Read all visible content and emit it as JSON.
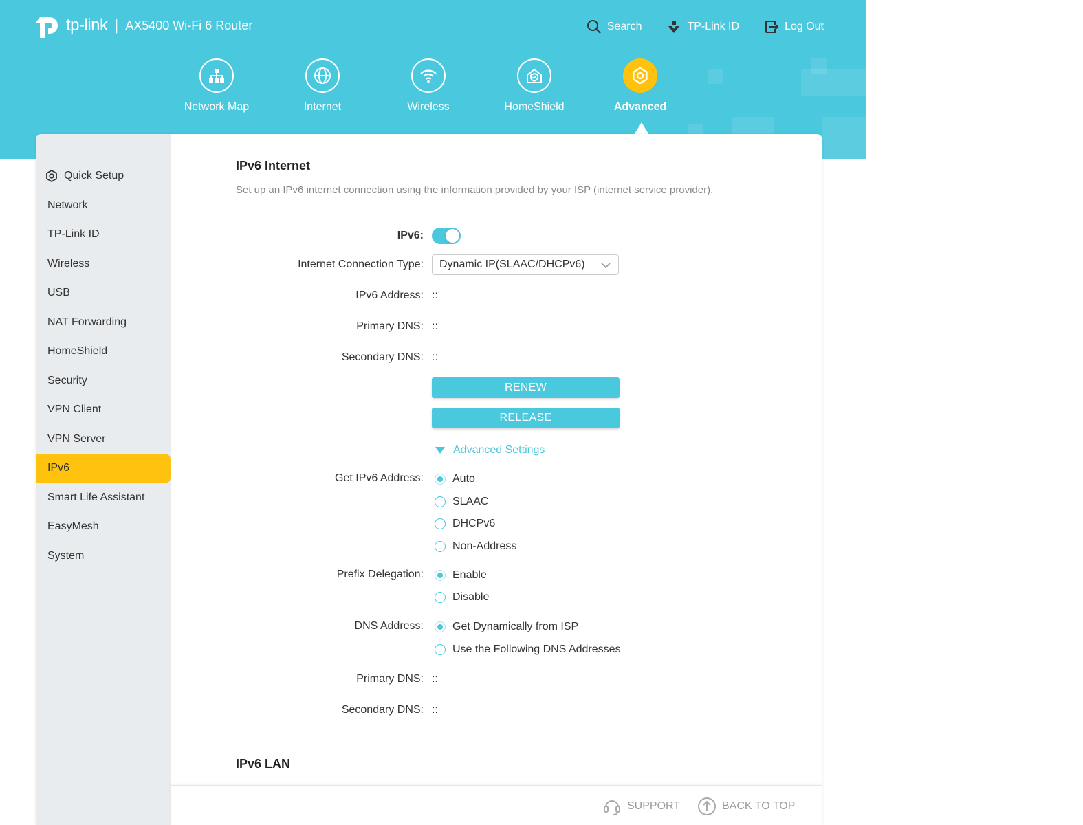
{
  "header": {
    "brand": "tp-link",
    "separator": "|",
    "model": "AX5400 Wi-Fi 6 Router",
    "links": {
      "search": "Search",
      "tplink_id": "TP-Link ID",
      "logout": "Log Out"
    }
  },
  "nav": {
    "network_map": "Network Map",
    "internet": "Internet",
    "wireless": "Wireless",
    "homeshield": "HomeShield",
    "advanced": "Advanced"
  },
  "sidebar": {
    "items": [
      "Quick Setup",
      "Network",
      "TP-Link ID",
      "Wireless",
      "USB",
      "NAT Forwarding",
      "HomeShield",
      "Security",
      "VPN Client",
      "VPN Server",
      "IPv6",
      "Smart Life Assistant",
      "EasyMesh",
      "System"
    ],
    "active": "IPv6"
  },
  "ipv6_internet": {
    "title": "IPv6 Internet",
    "description": "Set up an IPv6 internet connection using the information provided by your ISP (internet service provider).",
    "ipv6_label": "IPv6:",
    "ipv6_enabled": true,
    "connection_type_label": "Internet Connection Type:",
    "connection_type_value": "Dynamic IP(SLAAC/DHCPv6)",
    "ipv6_address_label": "IPv6 Address:",
    "ipv6_address_value": "::",
    "primary_dns_label": "Primary DNS:",
    "primary_dns_value": "::",
    "secondary_dns_label": "Secondary DNS:",
    "secondary_dns_value": "::",
    "renew_button": "RENEW",
    "release_button": "RELEASE",
    "advanced_settings": "Advanced Settings",
    "get_address_label": "Get IPv6 Address:",
    "get_address_options": [
      "Auto",
      "SLAAC",
      "DHCPv6",
      "Non-Address"
    ],
    "get_address_selected": "Auto",
    "prefix_delegation_label": "Prefix Delegation:",
    "prefix_delegation_options": [
      "Enable",
      "Disable"
    ],
    "prefix_delegation_selected": "Enable",
    "dns_address_label": "DNS Address:",
    "dns_address_options": [
      "Get Dynamically from ISP",
      "Use the Following DNS Addresses"
    ],
    "dns_address_selected": "Get Dynamically from ISP",
    "adv_primary_dns_label": "Primary DNS:",
    "adv_primary_dns_value": "::",
    "adv_secondary_dns_label": "Secondary DNS:",
    "adv_secondary_dns_value": "::"
  },
  "ipv6_lan": {
    "title": "IPv6 LAN"
  },
  "footer": {
    "support": "SUPPORT",
    "back_to_top": "BACK TO TOP"
  },
  "colors": {
    "accent": "#4ac8de",
    "active": "#ffc20e",
    "sidebar_bg": "#e9ecee"
  }
}
